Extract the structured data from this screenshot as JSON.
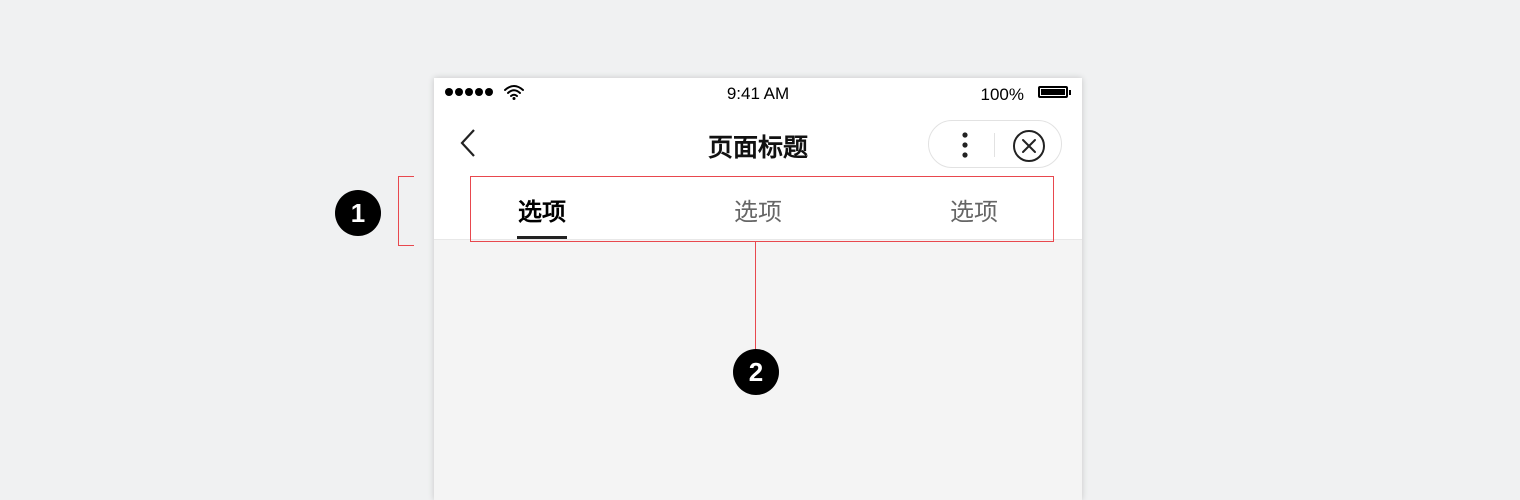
{
  "status_bar": {
    "time": "9:41 AM",
    "battery_percent": "100%",
    "signal_icon": "signal-dots-icon",
    "wifi_icon": "wifi-icon",
    "battery_icon": "battery-icon"
  },
  "nav_bar": {
    "title": "页面标题",
    "back_icon": "chevron-left-icon",
    "more_icon": "vertical-dots-icon",
    "close_icon": "circle-x-icon"
  },
  "tabs": {
    "items": [
      {
        "label": "选项",
        "active": true
      },
      {
        "label": "选项",
        "active": false
      },
      {
        "label": "选项",
        "active": false
      }
    ]
  },
  "annotations": {
    "badge_1": "1",
    "badge_2": "2",
    "color": "#e8484e"
  },
  "colors": {
    "background": "#f0f1f2",
    "page_background": "#f4f4f4",
    "tab_active": "#000000",
    "tab_inactive": "#666666"
  }
}
